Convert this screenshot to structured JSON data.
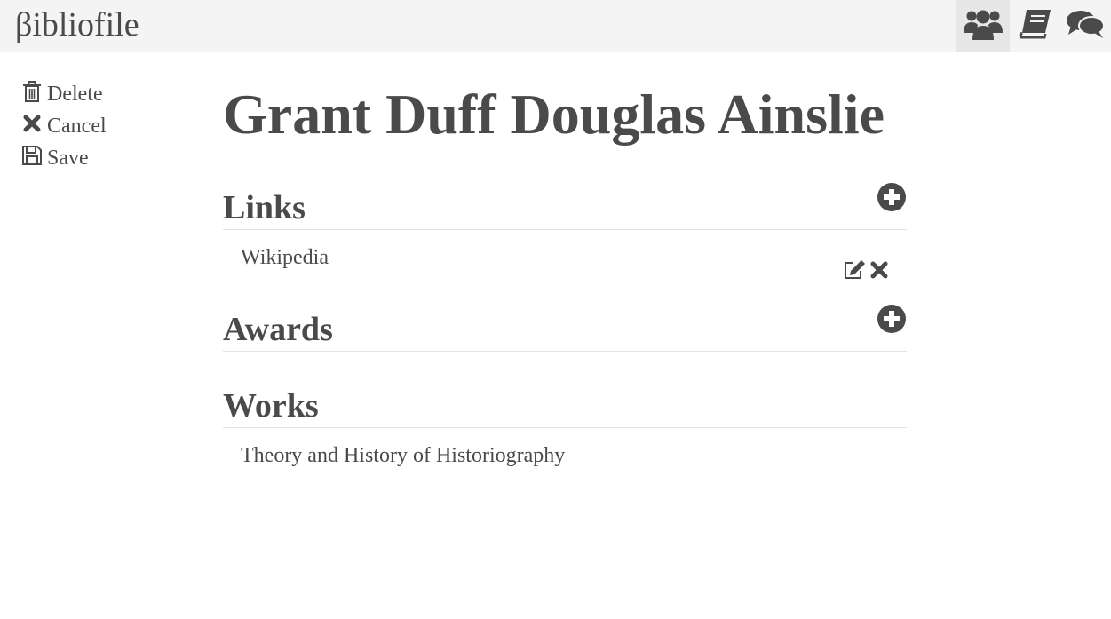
{
  "app": {
    "brand": "βibliofile"
  },
  "nav": {
    "items": [
      {
        "icon": "users-icon",
        "active": true
      },
      {
        "icon": "book-icon",
        "active": false
      },
      {
        "icon": "comments-icon",
        "active": false
      }
    ]
  },
  "sidebar": {
    "delete_label": "Delete",
    "cancel_label": "Cancel",
    "save_label": "Save"
  },
  "main": {
    "title": "Grant Duff Douglas Ainslie",
    "links": {
      "heading": "Links",
      "items": [
        {
          "label": "Wikipedia"
        }
      ]
    },
    "awards": {
      "heading": "Awards",
      "items": []
    },
    "works": {
      "heading": "Works",
      "items": [
        {
          "label": "Theory and History of Historiography"
        }
      ]
    }
  },
  "colors": {
    "text": "#4a4a4a",
    "topbar": "#f4f4f4",
    "active_nav": "#e7e7e7",
    "divider": "#e2e2e2"
  }
}
